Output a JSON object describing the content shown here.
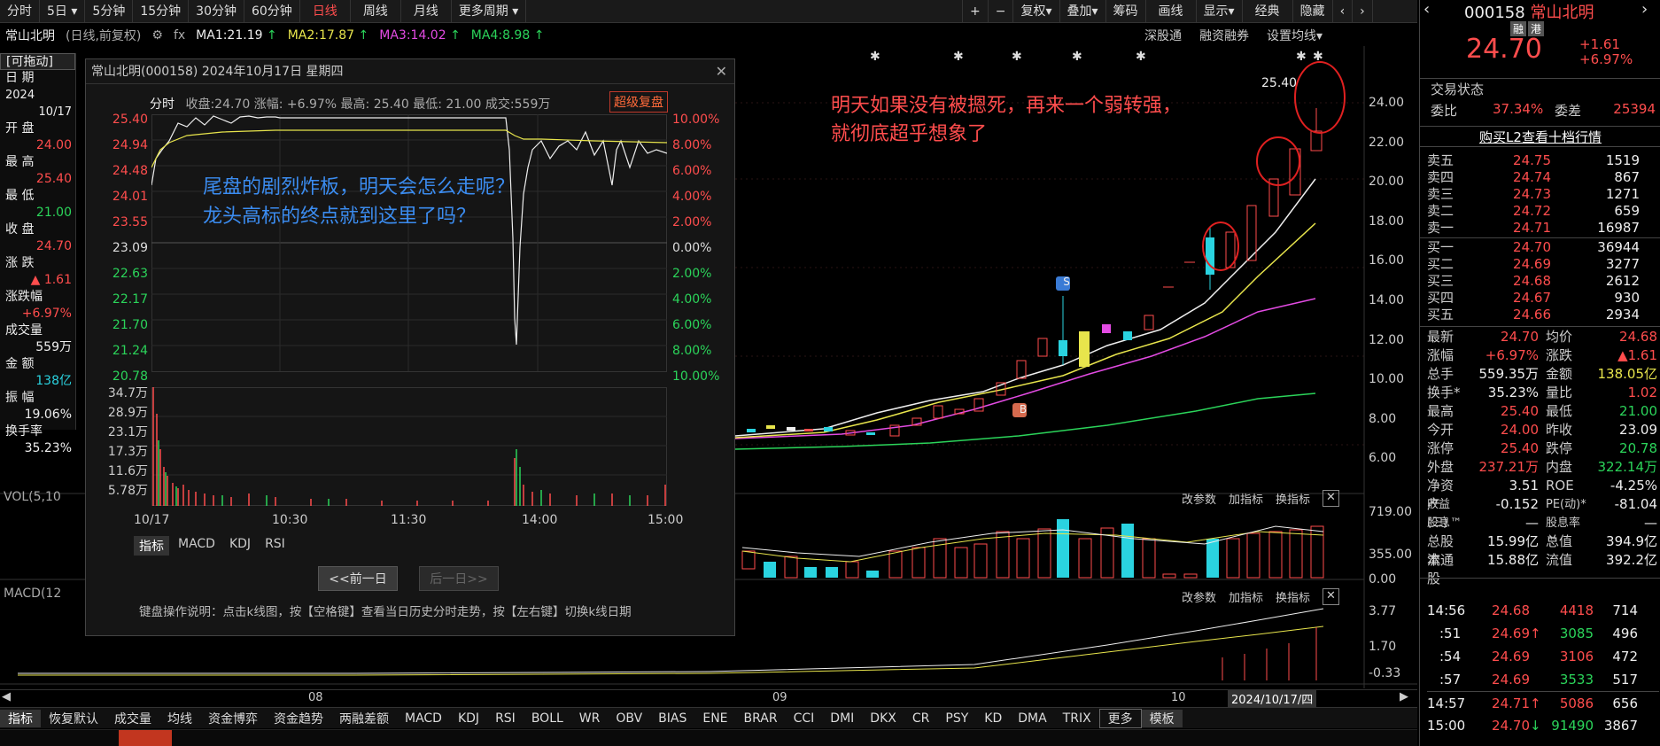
{
  "toolbar": {
    "periods": [
      "分时",
      "5日",
      "5分钟",
      "15分钟",
      "30分钟",
      "60分钟",
      "日线",
      "周线",
      "月线",
      "更多周期"
    ],
    "active_period": "日线",
    "right_tools": [
      "复权",
      "叠加",
      "筹码",
      "画线",
      "显示",
      "经典",
      "隐藏"
    ]
  },
  "header": {
    "stock_name": "常山北明",
    "stock_desc": "(日线,前复权)",
    "fx": "fx",
    "ma": [
      {
        "label": "MA1:21.19",
        "color": "#eeeeee"
      },
      {
        "label": "MA2:17.87",
        "color": "#e8e54c"
      },
      {
        "label": "MA3:14.02",
        "color": "#e34be3"
      },
      {
        "label": "MA4:8.98",
        "color": "#2bd45a"
      }
    ],
    "links": [
      "深股通",
      "融资融券",
      "设置均线"
    ]
  },
  "left_panel": {
    "drag": "[可拖动]",
    "date_label": "日 期",
    "year": "2024",
    "date": "10/17",
    "rows": [
      {
        "label": "开 盘",
        "value": "24.00",
        "color": "red"
      },
      {
        "label": "最 高",
        "value": "25.40",
        "color": "red"
      },
      {
        "label": "最 低",
        "value": "21.00",
        "color": "green"
      },
      {
        "label": "收 盘",
        "value": "24.70",
        "color": "red"
      },
      {
        "label": "涨 跌",
        "value": "▲ 1.61",
        "color": "red"
      },
      {
        "label": "涨跌幅",
        "value": "+6.97%",
        "color": "red"
      },
      {
        "label": "成交量",
        "value": "559万",
        "color": "white"
      },
      {
        "label": "金 额",
        "value": "138亿",
        "color": "cyan"
      },
      {
        "label": "振 幅",
        "value": "19.06%",
        "color": "white"
      },
      {
        "label": "换手率",
        "value": "35.23%",
        "color": "white"
      }
    ]
  },
  "popup": {
    "title": "常山北明(000158) 2024年10月17日 星期四",
    "info_label": "分时",
    "info": "收盘:24.70 涨幅: +6.97% 最高: 25.40 最低: 21.00 成交:559万",
    "super_btn": "超级复盘",
    "left_axis": [
      "25.40",
      "24.94",
      "24.48",
      "24.01",
      "23.55",
      "23.09",
      "22.63",
      "22.17",
      "21.70",
      "21.24",
      "20.78"
    ],
    "right_axis": [
      "10.00%",
      "8.00%",
      "6.00%",
      "4.00%",
      "2.00%",
      "0.00%",
      "2.00%",
      "4.00%",
      "6.00%",
      "8.00%",
      "10.00%"
    ],
    "vol_axis": [
      "34.7万",
      "28.9万",
      "23.1万",
      "17.3万",
      "11.6万",
      "5.78万"
    ],
    "time_axis": [
      "10/17",
      "10:30",
      "11:30",
      "14:00",
      "15:00"
    ],
    "tabs": [
      "指标",
      "MACD",
      "KDJ",
      "RSI"
    ],
    "prev_btn": "<<前一日",
    "next_btn": "后一日>>",
    "help": "键盘操作说明：点击k线图，按【空格键】查看当日历史分时走势，按【左右键】切换k线日期",
    "annotation1": "尾盘的剧烈炸板，明天会怎么走呢？",
    "annotation2": "龙头高标的终点就到这里了吗？"
  },
  "main_chart": {
    "annotation1": "明天如果没有被摁死，再来一个弱转强，",
    "annotation2": "就彻底超乎想象了",
    "high_label": "25.40",
    "price_axis": [
      "24.00",
      "22.00",
      "20.00",
      "18.00",
      "16.00",
      "14.00",
      "12.00",
      "10.00",
      "8.00",
      "6.00"
    ],
    "s_badge": "S",
    "b_badge": "B",
    "x_labels": [
      "08",
      "09",
      "10"
    ],
    "cursor_date": "2024/10/17/四"
  },
  "vol_panel": {
    "label": "VOL(5,10",
    "buttons": [
      "改参数",
      "加指标",
      "换指标"
    ],
    "axis": [
      "719.00",
      "355.00",
      "0.00"
    ]
  },
  "macd_panel": {
    "label": "MACD(12",
    "buttons": [
      "改参数",
      "加指标",
      "换指标"
    ],
    "axis": [
      "3.77",
      "1.70",
      "-0.33"
    ]
  },
  "bottom_tabs": [
    "指标",
    "恢复默认",
    "成交量",
    "均线",
    "资金博弈",
    "资金趋势",
    "两融差额",
    "MACD",
    "KDJ",
    "RSI",
    "BOLL",
    "WR",
    "OBV",
    "BIAS",
    "ENE",
    "BRAR",
    "CCI",
    "DMI",
    "DKX",
    "CR",
    "PSY",
    "KD",
    "DMA",
    "TRIX",
    "更多",
    "模板"
  ],
  "right_panel": {
    "code": "000158",
    "name": "常山北明",
    "tags": [
      "融",
      "港"
    ],
    "price": "24.70",
    "change": "+1.61",
    "pct": "+6.97%",
    "status_label": "交易状态",
    "ratio": {
      "label": "委比",
      "value": "37.34%",
      "diff_label": "委差",
      "diff": "25394"
    },
    "l2_link": "购买L2查看十档行情",
    "sells": [
      {
        "label": "卖五",
        "price": "24.75",
        "vol": "1519"
      },
      {
        "label": "卖四",
        "price": "24.74",
        "vol": "867"
      },
      {
        "label": "卖三",
        "price": "24.73",
        "vol": "1271"
      },
      {
        "label": "卖二",
        "price": "24.72",
        "vol": "659"
      },
      {
        "label": "卖一",
        "price": "24.71",
        "vol": "16987"
      }
    ],
    "buys": [
      {
        "label": "买一",
        "price": "24.70",
        "vol": "36944"
      },
      {
        "label": "买二",
        "price": "24.69",
        "vol": "3277"
      },
      {
        "label": "买三",
        "price": "24.68",
        "vol": "2612"
      },
      {
        "label": "买四",
        "price": "24.67",
        "vol": "930"
      },
      {
        "label": "买五",
        "price": "24.66",
        "vol": "2934"
      }
    ],
    "stats": [
      [
        "最新",
        "24.70",
        "red",
        "均价",
        "24.68",
        "red"
      ],
      [
        "涨幅",
        "+6.97%",
        "red",
        "涨跌",
        "▲1.61",
        "red"
      ],
      [
        "总手",
        "559.35万",
        "white",
        "金额",
        "138.05亿",
        "yellow"
      ],
      [
        "换手*",
        "35.23%",
        "white",
        "量比",
        "1.02",
        "red"
      ],
      [
        "最高",
        "25.40",
        "red",
        "最低",
        "21.00",
        "green"
      ],
      [
        "今开",
        "24.00",
        "red",
        "昨收",
        "23.09",
        "white"
      ],
      [
        "涨停",
        "25.40",
        "red",
        "跌停",
        "20.78",
        "green"
      ],
      [
        "外盘",
        "237.21万",
        "red",
        "内盘",
        "322.14万",
        "green"
      ],
      [
        "净资产",
        "3.51",
        "white",
        "ROE",
        "-4.25%",
        "white"
      ],
      [
        "收益(三)",
        "-0.152",
        "white",
        "PE(动)*",
        "-81.04",
        "white"
      ],
      [
        "股息™",
        "—",
        "white",
        "股息率™",
        "—",
        "white"
      ],
      [
        "总股本",
        "15.99亿",
        "white",
        "总值",
        "394.9亿",
        "white"
      ],
      [
        "流通股",
        "15.88亿",
        "white",
        "流值",
        "392.2亿",
        "white"
      ]
    ],
    "ticks": [
      {
        "time": "14:56",
        "price": "24.68",
        "arrow": "",
        "vol": "4418",
        "n": "714"
      },
      {
        "time": ":51",
        "price": "24.69",
        "arrow": "↑",
        "vol": "3085",
        "n": "496"
      },
      {
        "time": ":54",
        "price": "24.69",
        "arrow": "",
        "vol": "3106",
        "n": "472"
      },
      {
        "time": ":57",
        "price": "24.69",
        "arrow": "",
        "vol": "3533",
        "n": "517"
      },
      {
        "time": "14:57",
        "price": "24.71",
        "arrow": "↑",
        "vol": "5086",
        "n": "656"
      },
      {
        "time": "15:00",
        "price": "24.70",
        "arrow": "↓",
        "vol": "91490",
        "n": "3867"
      }
    ]
  },
  "chart_data": {
    "type": "candlestick",
    "title": "",
    "high_label": "25.40",
    "ylim": [
      6,
      26
    ]
  }
}
